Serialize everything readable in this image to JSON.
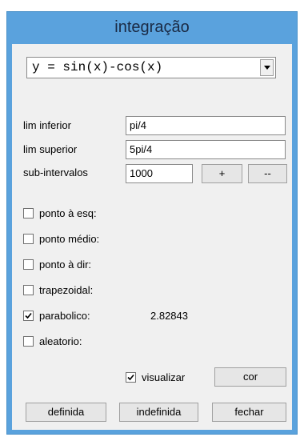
{
  "window": {
    "title": "integração"
  },
  "function_select": {
    "value": "y = sin(x)-cos(x)"
  },
  "fields": {
    "lim_inferior": {
      "label": "lim inferior",
      "value": "pi/4"
    },
    "lim_superior": {
      "label": "lim superior",
      "value": "5pi/4"
    },
    "sub_intervalos": {
      "label": "sub-intervalos",
      "value": "1000"
    }
  },
  "buttons": {
    "plus": "+",
    "minus": "--",
    "cor": "cor",
    "definida": "definida",
    "indefinida": "indefinida",
    "fechar": "fechar"
  },
  "methods": [
    {
      "label": "ponto à esq:",
      "checked": false,
      "result": ""
    },
    {
      "label": "ponto médio:",
      "checked": false,
      "result": ""
    },
    {
      "label": "ponto à dir:",
      "checked": false,
      "result": ""
    },
    {
      "label": "trapezoidal:",
      "checked": false,
      "result": ""
    },
    {
      "label": "parabolico:",
      "checked": true,
      "result": "2.82843"
    },
    {
      "label": "aleatorio:",
      "checked": false,
      "result": ""
    }
  ],
  "visualizar": {
    "label": "visualizar",
    "checked": true
  }
}
